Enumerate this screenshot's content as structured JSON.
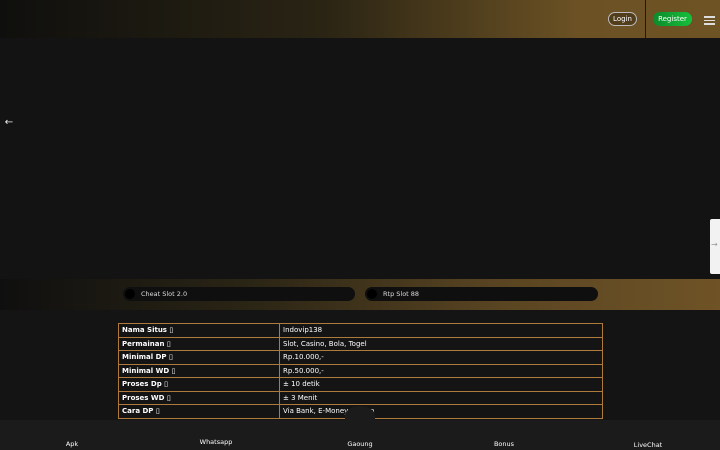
{
  "header": {
    "login_label": "Login",
    "register_label": "Register",
    "register_color": "#16c03c"
  },
  "hero": {
    "back_icon": "arrow-left-icon"
  },
  "links": [
    {
      "label": "Cheat Slot 2.0"
    },
    {
      "label": "Rtp Slot 88"
    }
  ],
  "info_table": [
    {
      "key": "Nama Situs ▯",
      "value": "Indovip138"
    },
    {
      "key": "Permainan ▯",
      "value": "Slot, Casino, Bola, Togel"
    },
    {
      "key": "Minimal DP ▯",
      "value": "Rp.10.000,-"
    },
    {
      "key": "Minimal WD ▯",
      "value": "Rp.50.000,-"
    },
    {
      "key": "Proses Dp ▯",
      "value": "± 10 detik"
    },
    {
      "key": "Proses WD ▯",
      "value": "± 3 Menit"
    },
    {
      "key": "Cara DP ▯",
      "value": "Via Bank, E-Money,   Instan"
    }
  ],
  "bottom_nav": [
    {
      "label": "Apk"
    },
    {
      "label": "Whatsapp"
    },
    {
      "label": "Gaoung"
    },
    {
      "label": "Bonus"
    },
    {
      "label": "LiveChat"
    }
  ],
  "colors": {
    "background": "#141414",
    "accent_gold": "#6f5326",
    "table_border": "#b07a3c"
  }
}
